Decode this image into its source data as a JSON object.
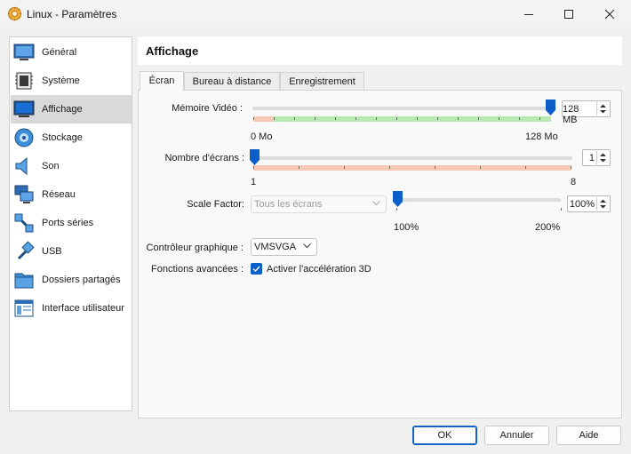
{
  "window": {
    "title": "Linux - Paramètres"
  },
  "sidebar": {
    "items": [
      {
        "label": "Général",
        "icon": "general-monitor-icon"
      },
      {
        "label": "Système",
        "icon": "system-chip-icon"
      },
      {
        "label": "Affichage",
        "icon": "display-monitor-icon",
        "active": true
      },
      {
        "label": "Stockage",
        "icon": "storage-disk-icon"
      },
      {
        "label": "Son",
        "icon": "speaker-icon"
      },
      {
        "label": "Réseau",
        "icon": "network-icon"
      },
      {
        "label": "Ports séries",
        "icon": "serial-port-icon"
      },
      {
        "label": "USB",
        "icon": "usb-icon"
      },
      {
        "label": "Dossiers partagés",
        "icon": "folder-icon"
      },
      {
        "label": "Interface utilisateur",
        "icon": "user-interface-icon"
      }
    ]
  },
  "header": {
    "title": "Affichage"
  },
  "tabs": [
    {
      "label": "Écran",
      "active": true
    },
    {
      "label": "Bureau à distance"
    },
    {
      "label": "Enregistrement"
    }
  ],
  "screen": {
    "video_memory": {
      "label": "Mémoire Vidéo :",
      "value": "128 MB",
      "min_label": "0 Mo",
      "max_label": "128 Mo"
    },
    "monitor_count": {
      "label": "Nombre d'écrans :",
      "value": "1",
      "min_label": "1",
      "max_label": "8"
    },
    "scale_factor": {
      "label": "Scale Factor:",
      "scope": "Tous les écrans",
      "value": "100%",
      "min_label": "100%",
      "max_label": "200%"
    },
    "graphics_controller": {
      "label": "Contrôleur graphique :",
      "value": "VMSVGA"
    },
    "advanced": {
      "label": "Fonctions avancées :",
      "checkbox_label": "Activer l'accélération 3D",
      "checked": true
    }
  },
  "buttons": {
    "ok": "OK",
    "cancel": "Annuler",
    "help": "Aide"
  },
  "colors": {
    "accent": "#0a5fc8",
    "ok_range": "#b7eab0",
    "warn_range": "#f6c9b4",
    "selected_item": "#d9d9d9"
  }
}
